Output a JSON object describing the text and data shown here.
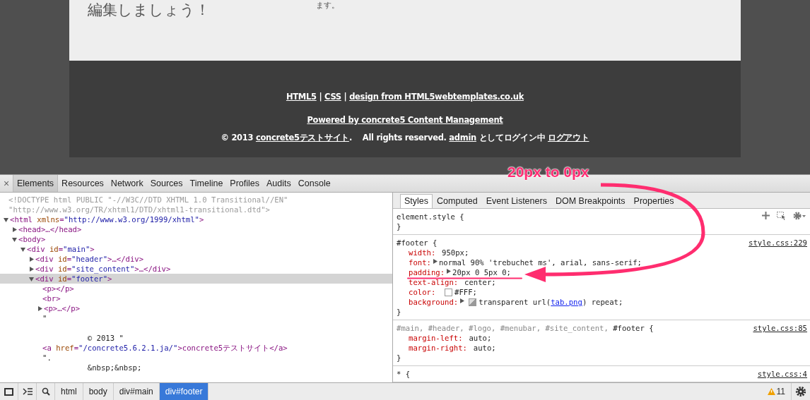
{
  "page": {
    "heading": "編集しましょう！",
    "snippet": "ます。",
    "footer_lines": [
      [
        {
          "text": "HTML5",
          "link": true
        },
        {
          "text": " | ",
          "link": false
        },
        {
          "text": "CSS",
          "link": true
        },
        {
          "text": " | ",
          "link": false
        },
        {
          "text": "design from HTML5webtemplates.co.uk",
          "link": true
        }
      ],
      [
        {
          "text": "Powered by concrete5 Content Management",
          "link": true
        }
      ],
      [
        {
          "text": "© 2013 ",
          "link": false
        },
        {
          "text": "concrete5テストサイト",
          "link": true
        },
        {
          "text": ".    All rights reserved. ",
          "link": false
        },
        {
          "text": "admin",
          "link": true
        },
        {
          "text": " としてログイン中 ",
          "link": false
        },
        {
          "text": "ログアウト",
          "link": true
        }
      ]
    ]
  },
  "annotation": {
    "text": "20px to 0px"
  },
  "devtools": {
    "close": "×",
    "tabs": [
      {
        "label": "Elements",
        "selected": true
      },
      {
        "label": "Resources",
        "selected": false
      },
      {
        "label": "Network",
        "selected": false
      },
      {
        "label": "Sources",
        "selected": false
      },
      {
        "label": "Timeline",
        "selected": false
      },
      {
        "label": "Profiles",
        "selected": false
      },
      {
        "label": "Audits",
        "selected": false
      },
      {
        "label": "Console",
        "selected": false
      }
    ],
    "dom": [
      {
        "kind": "comment",
        "lines": [
          "<!DOCTYPE html PUBLIC \"-//W3C//DTD XHTML 1.0 Transitional//EN\"",
          "\"http://www.w3.org/TR/xhtml1/DTD/xhtml1-transitional.dtd\">"
        ]
      },
      {
        "kind": "element",
        "text": "<html xmlns=\"http://www.w3.org/1999/xhtml\">",
        "expanded": true,
        "selected": false,
        "children": [
          {
            "kind": "element",
            "text": "<head>…</head>",
            "expanded": false,
            "selected": false
          },
          {
            "kind": "element",
            "text": "<body>",
            "expanded": true,
            "selected": false,
            "children": [
              {
                "kind": "element",
                "text": "<div id=\"main\">",
                "expanded": true,
                "selected": false,
                "children": [
                  {
                    "kind": "element",
                    "text": "<div id=\"header\">…</div>",
                    "expanded": false,
                    "selected": false
                  },
                  {
                    "kind": "element",
                    "text": "<div id=\"site_content\">…</div>",
                    "expanded": false,
                    "selected": false
                  },
                  {
                    "kind": "element",
                    "text": "<div id=\"footer\">",
                    "expanded": true,
                    "selected": true,
                    "children": [
                      {
                        "kind": "leaf",
                        "text": "<p></p>"
                      },
                      {
                        "kind": "leaf",
                        "text": "<br>"
                      },
                      {
                        "kind": "element",
                        "text": "<p>…</p>",
                        "expanded": false,
                        "selected": false
                      },
                      {
                        "kind": "text",
                        "lines": [
                          "\"",
                          "\n          © 2013 \""
                        ]
                      },
                      {
                        "kind": "leaf",
                        "text": "<a href=\"/concrete5.6.2.1.ja/\">concrete5テストサイト</a>"
                      },
                      {
                        "kind": "text",
                        "lines": [
                          "\".",
                          "          &nbsp;&nbsp;"
                        ]
                      }
                    ]
                  }
                ]
              }
            ]
          }
        ]
      }
    ],
    "subtabs": [
      {
        "label": "Styles",
        "selected": true
      },
      {
        "label": "Computed",
        "selected": false
      },
      {
        "label": "Event Listeners",
        "selected": false
      },
      {
        "label": "DOM Breakpoints",
        "selected": false
      },
      {
        "label": "Properties",
        "selected": false
      }
    ],
    "rules": [
      {
        "selector": [
          {
            "text": "element.style {",
            "matched": true
          }
        ],
        "toolbar": true,
        "closing": "}"
      },
      {
        "selector": [
          {
            "text": "#footer {",
            "matched": true
          }
        ],
        "source": "style.css:229",
        "toolbar": false,
        "closing": "}",
        "properties": [
          {
            "name": "width:",
            "expandable": false,
            "parts": [
              {
                "text": "950px;",
                "link": false
              }
            ]
          },
          {
            "name": "font:",
            "expandable": true,
            "parts": [
              {
                "text": "normal 90% 'trebuchet ms', arial, sans-serif;",
                "link": false
              }
            ]
          },
          {
            "name": "padding:",
            "expandable": true,
            "parts": [
              {
                "text": "20px 0 5px 0;",
                "link": false
              }
            ]
          },
          {
            "name": "text-align:",
            "expandable": false,
            "parts": [
              {
                "text": "center;",
                "link": false
              }
            ]
          },
          {
            "name": "color:",
            "expandable": false,
            "swatch": {
              "kind": "color",
              "color": "#ffffff"
            },
            "parts": [
              {
                "text": "#FFF;",
                "link": false
              }
            ]
          },
          {
            "name": "background:",
            "expandable": true,
            "swatch": {
              "kind": "image"
            },
            "parts": [
              {
                "text": "transparent url(",
                "link": false
              },
              {
                "text": "tab.png",
                "link": true
              },
              {
                "text": ") repeat;",
                "link": false
              }
            ]
          }
        ]
      },
      {
        "selector": [
          {
            "text": "#main, #header, #logo, #menubar, #site_content, ",
            "matched": false
          },
          {
            "text": "#footer",
            "matched": true
          },
          {
            "text": " {",
            "matched": true
          }
        ],
        "source": "style.css:85",
        "toolbar": false,
        "closing": "}",
        "properties": [
          {
            "name": "margin-left:",
            "expandable": false,
            "parts": [
              {
                "text": "auto;",
                "link": false
              }
            ]
          },
          {
            "name": "margin-right:",
            "expandable": false,
            "parts": [
              {
                "text": "auto;",
                "link": false
              }
            ]
          }
        ]
      },
      {
        "selector": [
          {
            "text": "* {",
            "matched": true
          }
        ],
        "source": "style.css:4",
        "toolbar": false
      }
    ],
    "breadcrumbs": [
      {
        "label": "html",
        "selected": false
      },
      {
        "label": "body",
        "selected": false
      },
      {
        "label": "div#main",
        "selected": false
      },
      {
        "label": "div#footer",
        "selected": true
      }
    ],
    "warnings": "11"
  }
}
